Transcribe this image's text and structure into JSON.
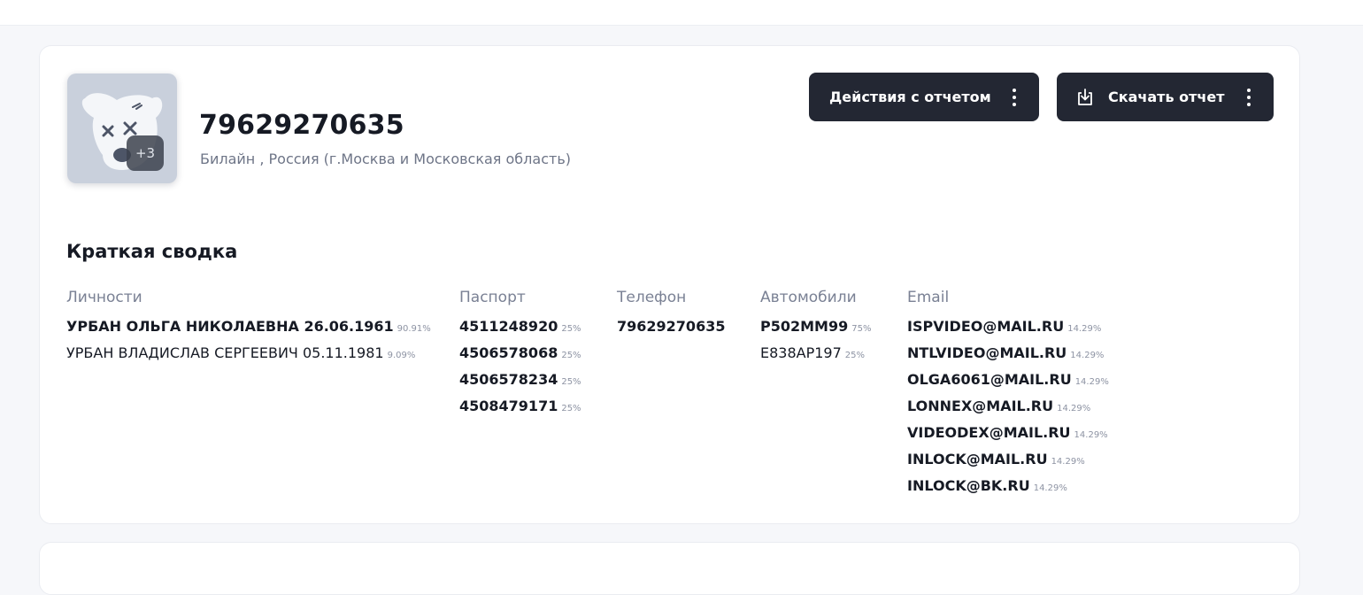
{
  "header": {
    "title": "79629270635",
    "subtitle": "Билайн , Россия (г.Москва и Московская область)",
    "avatar": {
      "icon": "vk-camera-bear-icon",
      "extra_count": "+3"
    }
  },
  "toolbar": {
    "actions_label": "Действия с отчетом",
    "download_label": "Скачать отчет",
    "button_color": "#232733"
  },
  "summary": {
    "title": "Краткая сводка",
    "persons": {
      "header": "Личности",
      "items": [
        {
          "value": "УРБАН ОЛЬГА НИКОЛАЕВНА 26.06.1961",
          "percent": "90.91%"
        },
        {
          "value": "УРБАН ВЛАДИСЛАВ СЕРГЕЕВИЧ 05.11.1981",
          "percent": "9.09%"
        }
      ]
    },
    "passports": {
      "header": "Паспорт",
      "items": [
        {
          "value": "4511248920",
          "percent": "25%"
        },
        {
          "value": "4506578068",
          "percent": "25%"
        },
        {
          "value": "4506578234",
          "percent": "25%"
        },
        {
          "value": "4508479171",
          "percent": "25%"
        }
      ]
    },
    "phones": {
      "header": "Телефон",
      "items": [
        {
          "value": "79629270635"
        }
      ]
    },
    "cars": {
      "header": "Автомобили",
      "items": [
        {
          "value": "Р502ММ99",
          "percent": "75%"
        },
        {
          "value": "Е838АР197",
          "percent": "25%"
        }
      ]
    },
    "emails": {
      "header": "Email",
      "items": [
        {
          "value": "ISPVIDEO@MAIL.RU",
          "percent": "14.29%"
        },
        {
          "value": "NTLVIDEO@MAIL.RU",
          "percent": "14.29%"
        },
        {
          "value": "OLGA6061@MAIL.RU",
          "percent": "14.29%"
        },
        {
          "value": "LONNEX@MAIL.RU",
          "percent": "14.29%"
        },
        {
          "value": "VIDEODEX@MAIL.RU",
          "percent": "14.29%"
        },
        {
          "value": "INLOCK@MAIL.RU",
          "percent": "14.29%"
        },
        {
          "value": "INLOCK@BK.RU",
          "percent": "14.29%"
        }
      ]
    }
  }
}
